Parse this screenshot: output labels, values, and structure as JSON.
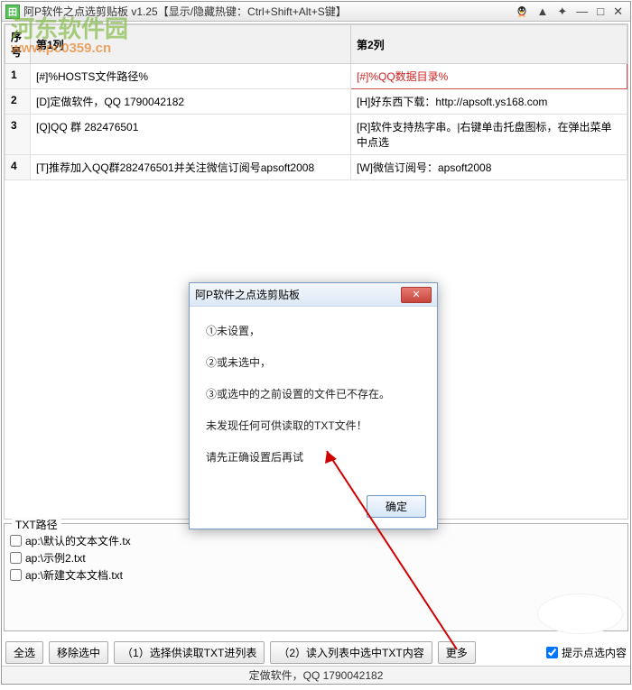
{
  "title": "阿P软件之点选剪贴板 v1.25【显示/隐藏热键：Ctrl+Shift+Alt+S键】",
  "watermark": {
    "line1": "河东软件园",
    "line2": "www.pc0359.cn"
  },
  "icons": {
    "app": "grid-icon",
    "qq": "qq-icon",
    "pin": "▲",
    "star": "✦",
    "min": "—",
    "max": "□",
    "close": "✕"
  },
  "table": {
    "headers": {
      "num": "序号",
      "col1": "第1列",
      "col2": "第2列"
    },
    "rows": [
      {
        "n": "1",
        "c1": "[#]%HOSTS文件路径%",
        "c2": "[#]%QQ数据目录%",
        "hl": true
      },
      {
        "n": "2",
        "c1": "[D]定做软件，QQ 1790042182",
        "c2": "[H]好东西下载：http://apsoft.ys168.com"
      },
      {
        "n": "3",
        "c1": "[Q]QQ 群 282476501",
        "c2": "[R]软件支持热字串。|右键单击托盘图标，在弹出菜单中点选"
      },
      {
        "n": "4",
        "c1": "[T]推荐加入QQ群282476501并关注微信订阅号apsoft2008",
        "c2": "[W]微信订阅号：apsoft2008"
      }
    ]
  },
  "pathpanel": {
    "legend": "TXT路径",
    "files": [
      "ap:\\默认的文本文件.tx",
      "ap:\\示例2.txt",
      "ap:\\新建文本文档.txt"
    ]
  },
  "buttons": {
    "selectall": "全选",
    "removesel": "移除选中",
    "load": "（1）选择供读取TXT进列表",
    "read": "（2）读入列表中选中TXT内容",
    "more": "更多",
    "hintchk": "提示点选内容"
  },
  "statusbar": "定做软件，QQ 1790042182",
  "dialog": {
    "title": "阿P软件之点选剪贴板",
    "line1": "①未设置，",
    "line2": "②或未选中，",
    "line3": "③或选中的之前设置的文件已不存在。",
    "line4": "未发现任何可供读取的TXT文件！",
    "line5": "请先正确设置后再试",
    "ok": "确定"
  }
}
